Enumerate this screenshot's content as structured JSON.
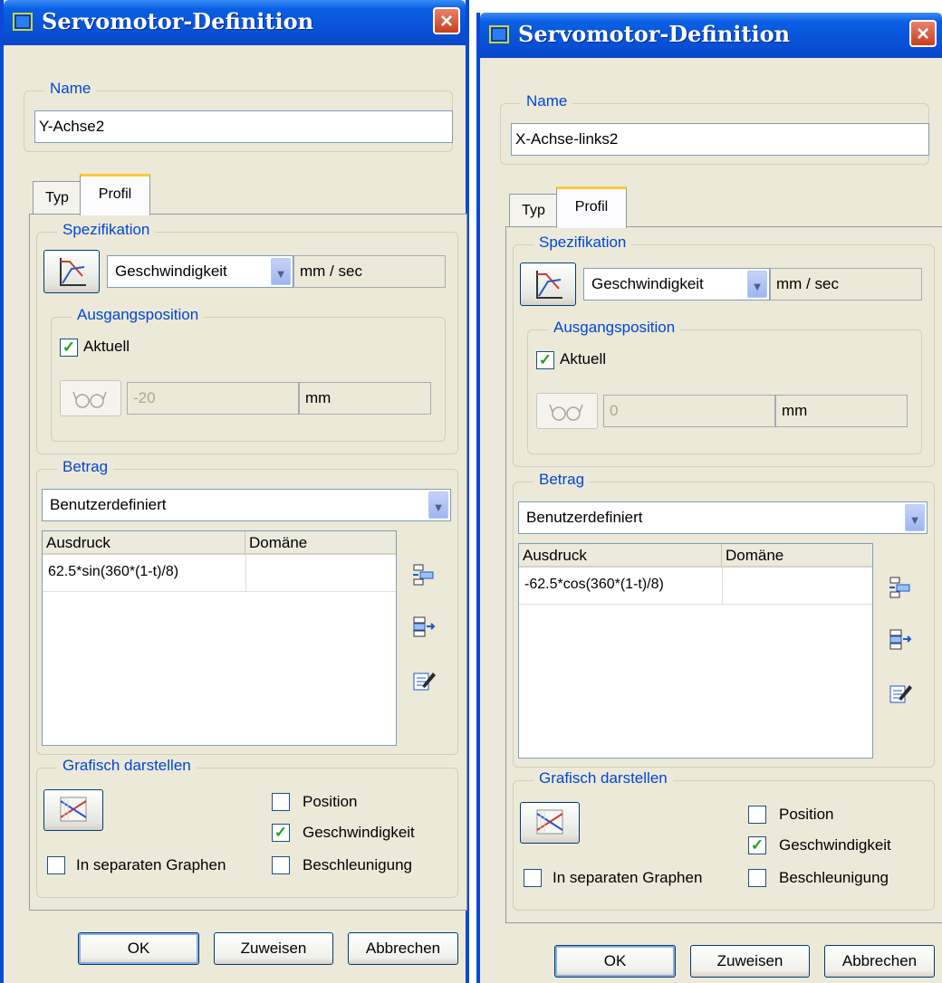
{
  "dialogs": [
    {
      "title": "Servomotor-Definition",
      "close_glyph": "×",
      "name_label": "Name",
      "name_value": "Y-Achse2",
      "tabs": [
        "Typ",
        "Profil"
      ],
      "spec_label": "Spezifikation",
      "spec_select": "Geschwindigkeit",
      "spec_unit": "mm / sec",
      "initial_label": "Ausgangsposition",
      "current_label": "Aktuell",
      "current_checked": true,
      "position_value": "-20",
      "position_unit": "mm",
      "magnitude_label": "Betrag",
      "magnitude_select": "Benutzerdefiniert",
      "col_expression": "Ausdruck",
      "col_domain": "Domäne",
      "rows": [
        {
          "expression": "62.5*sin(360*(1-t)/8)",
          "domain": ""
        }
      ],
      "graph_label": "Grafisch darstellen",
      "opt_position": "Position",
      "opt_position_checked": false,
      "opt_velocity": "Geschwindigkeit",
      "opt_velocity_checked": true,
      "opt_acceleration": "Beschleunigung",
      "opt_acceleration_checked": false,
      "opt_separate": "In separaten Graphen",
      "opt_separate_checked": false,
      "ok": "OK",
      "apply": "Zuweisen",
      "cancel": "Abbrechen"
    },
    {
      "title": "Servomotor-Definition",
      "close_glyph": "×",
      "name_label": "Name",
      "name_value": "X-Achse-links2",
      "tabs": [
        "Typ",
        "Profil"
      ],
      "spec_label": "Spezifikation",
      "spec_select": "Geschwindigkeit",
      "spec_unit": "mm / sec",
      "initial_label": "Ausgangsposition",
      "current_label": "Aktuell",
      "current_checked": true,
      "position_value": "0",
      "position_unit": "mm",
      "magnitude_label": "Betrag",
      "magnitude_select": "Benutzerdefiniert",
      "col_expression": "Ausdruck",
      "col_domain": "Domäne",
      "rows": [
        {
          "expression": "-62.5*cos(360*(1-t)/8)",
          "domain": ""
        }
      ],
      "graph_label": "Grafisch darstellen",
      "opt_position": "Position",
      "opt_position_checked": false,
      "opt_velocity": "Geschwindigkeit",
      "opt_velocity_checked": true,
      "opt_acceleration": "Beschleunigung",
      "opt_acceleration_checked": false,
      "opt_separate": "In separaten Graphen",
      "opt_separate_checked": false,
      "ok": "OK",
      "apply": "Zuweisen",
      "cancel": "Abbrechen"
    }
  ],
  "icons": {
    "dialog": "window-icon",
    "profile": "profile-curve-icon",
    "glasses": "glasses-icon",
    "insert_row": "insert-row-icon",
    "add_row": "add-row-icon",
    "edit": "edit-pencil-icon",
    "graph": "graph-icon"
  },
  "colors": {
    "titlebar": "#0853d8",
    "dialog_bg": "#ece9d8",
    "group_label": "#0046d5",
    "tab_highlight": "#ffc83c",
    "check_mark": "#21a121"
  }
}
